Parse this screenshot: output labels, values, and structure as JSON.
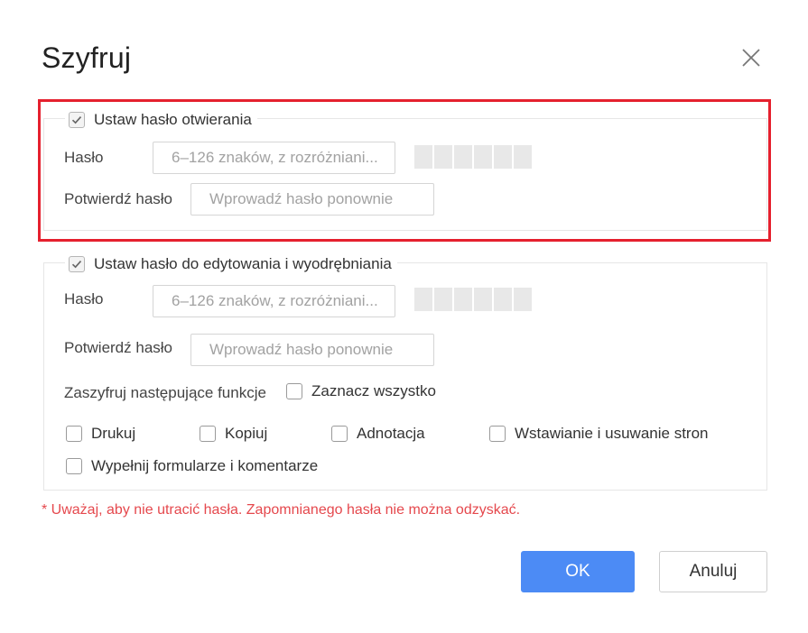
{
  "dialog": {
    "title": "Szyfruj",
    "close_icon": "close-icon"
  },
  "open_password": {
    "checkbox_label": "Ustaw hasło otwierania",
    "checked": true,
    "password_label": "Hasło",
    "password_placeholder": "6–126 znaków, z rozróżniani...",
    "confirm_label": "Potwierdź hasło",
    "confirm_placeholder": "Wprowadź hasło ponownie"
  },
  "edit_password": {
    "checkbox_label": "Ustaw hasło do edytowania i wyodrębniania",
    "checked": true,
    "password_label": "Hasło",
    "password_placeholder": "6–126 znaków, z rozróżniani...",
    "confirm_label": "Potwierdź hasło",
    "confirm_placeholder": "Wprowadź hasło ponownie",
    "functions_label": "Zaszyfruj następujące funkcje",
    "select_all_label": "Zaznacz wszystko",
    "functions": [
      {
        "label": "Drukuj",
        "checked": false
      },
      {
        "label": "Kopiuj",
        "checked": false
      },
      {
        "label": "Adnotacja",
        "checked": false
      },
      {
        "label": "Wstawianie i usuwanie stron",
        "checked": false
      },
      {
        "label": "Wypełnij formularze i komentarze",
        "checked": false
      }
    ]
  },
  "warning": "* Uważaj, aby nie utracić hasła. Zapomnianego hasła nie można odzyskać.",
  "buttons": {
    "ok": "OK",
    "cancel": "Anuluj"
  },
  "colors": {
    "accent": "#4c8bf5",
    "highlight_border": "#e5202e",
    "warning_text": "#e5484d"
  }
}
